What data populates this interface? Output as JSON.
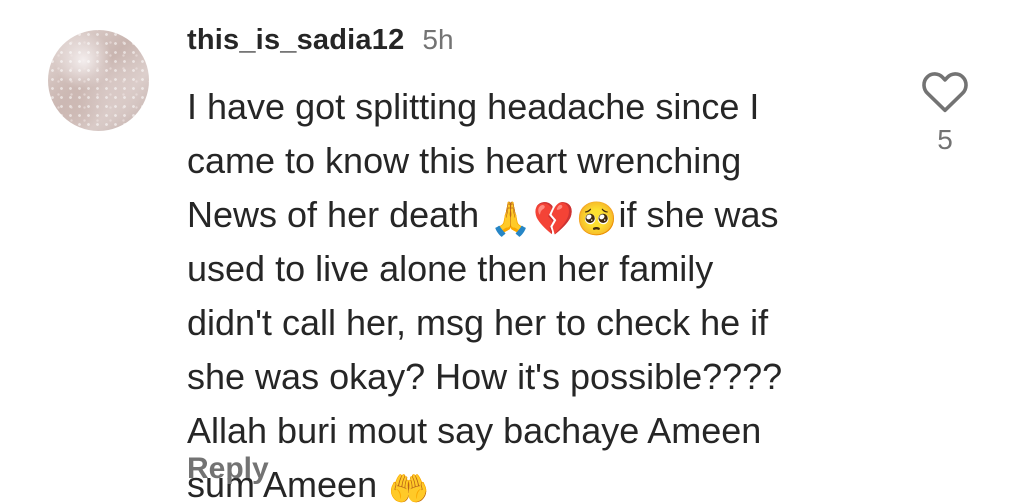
{
  "comment": {
    "username": "this_is_sadia12",
    "time": "5h",
    "lines": [
      "I have got splitting headache since I",
      "came to know this heart wrenching",
      [
        "News of her death ",
        "if she was"
      ],
      "used to live alone then her family",
      "didn't call her, msg her to check he if",
      "she was okay? How it's possible????",
      "Allah buri mout say bachaye Ameen",
      [
        "sum Ameen ",
        ""
      ]
    ],
    "emojis": {
      "pray": "🙏",
      "broken_heart": "💔",
      "pleading_face": "🥺",
      "open_hands": "🤲"
    },
    "reply_label": "Reply",
    "like_count": "5",
    "like_icon": "heart-outline-icon"
  }
}
